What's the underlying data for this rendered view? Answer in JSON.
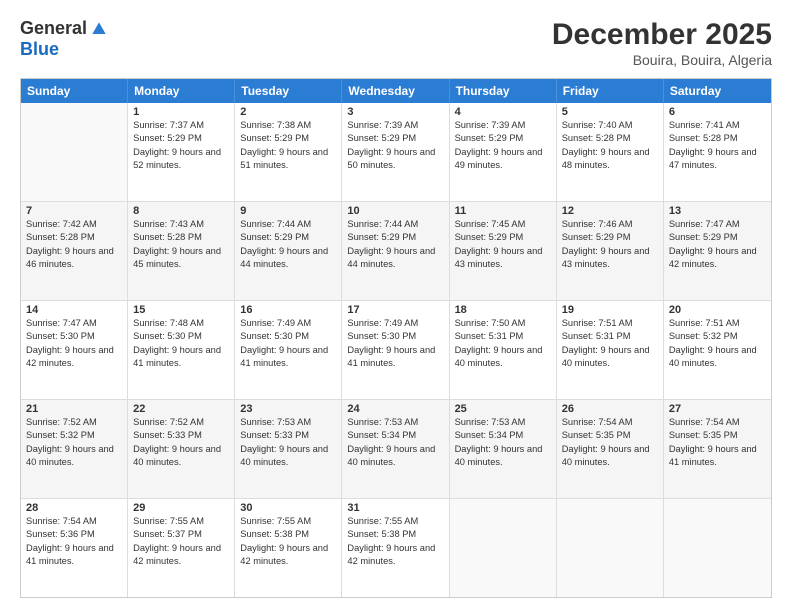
{
  "logo": {
    "general": "General",
    "blue": "Blue"
  },
  "title": "December 2025",
  "location": "Bouira, Bouira, Algeria",
  "days_of_week": [
    "Sunday",
    "Monday",
    "Tuesday",
    "Wednesday",
    "Thursday",
    "Friday",
    "Saturday"
  ],
  "weeks": [
    [
      {
        "day": "",
        "sunrise": "",
        "sunset": "",
        "daylight": ""
      },
      {
        "day": "1",
        "sunrise": "Sunrise: 7:37 AM",
        "sunset": "Sunset: 5:29 PM",
        "daylight": "Daylight: 9 hours and 52 minutes."
      },
      {
        "day": "2",
        "sunrise": "Sunrise: 7:38 AM",
        "sunset": "Sunset: 5:29 PM",
        "daylight": "Daylight: 9 hours and 51 minutes."
      },
      {
        "day": "3",
        "sunrise": "Sunrise: 7:39 AM",
        "sunset": "Sunset: 5:29 PM",
        "daylight": "Daylight: 9 hours and 50 minutes."
      },
      {
        "day": "4",
        "sunrise": "Sunrise: 7:39 AM",
        "sunset": "Sunset: 5:29 PM",
        "daylight": "Daylight: 9 hours and 49 minutes."
      },
      {
        "day": "5",
        "sunrise": "Sunrise: 7:40 AM",
        "sunset": "Sunset: 5:28 PM",
        "daylight": "Daylight: 9 hours and 48 minutes."
      },
      {
        "day": "6",
        "sunrise": "Sunrise: 7:41 AM",
        "sunset": "Sunset: 5:28 PM",
        "daylight": "Daylight: 9 hours and 47 minutes."
      }
    ],
    [
      {
        "day": "7",
        "sunrise": "Sunrise: 7:42 AM",
        "sunset": "Sunset: 5:28 PM",
        "daylight": "Daylight: 9 hours and 46 minutes."
      },
      {
        "day": "8",
        "sunrise": "Sunrise: 7:43 AM",
        "sunset": "Sunset: 5:28 PM",
        "daylight": "Daylight: 9 hours and 45 minutes."
      },
      {
        "day": "9",
        "sunrise": "Sunrise: 7:44 AM",
        "sunset": "Sunset: 5:29 PM",
        "daylight": "Daylight: 9 hours and 44 minutes."
      },
      {
        "day": "10",
        "sunrise": "Sunrise: 7:44 AM",
        "sunset": "Sunset: 5:29 PM",
        "daylight": "Daylight: 9 hours and 44 minutes."
      },
      {
        "day": "11",
        "sunrise": "Sunrise: 7:45 AM",
        "sunset": "Sunset: 5:29 PM",
        "daylight": "Daylight: 9 hours and 43 minutes."
      },
      {
        "day": "12",
        "sunrise": "Sunrise: 7:46 AM",
        "sunset": "Sunset: 5:29 PM",
        "daylight": "Daylight: 9 hours and 43 minutes."
      },
      {
        "day": "13",
        "sunrise": "Sunrise: 7:47 AM",
        "sunset": "Sunset: 5:29 PM",
        "daylight": "Daylight: 9 hours and 42 minutes."
      }
    ],
    [
      {
        "day": "14",
        "sunrise": "Sunrise: 7:47 AM",
        "sunset": "Sunset: 5:30 PM",
        "daylight": "Daylight: 9 hours and 42 minutes."
      },
      {
        "day": "15",
        "sunrise": "Sunrise: 7:48 AM",
        "sunset": "Sunset: 5:30 PM",
        "daylight": "Daylight: 9 hours and 41 minutes."
      },
      {
        "day": "16",
        "sunrise": "Sunrise: 7:49 AM",
        "sunset": "Sunset: 5:30 PM",
        "daylight": "Daylight: 9 hours and 41 minutes."
      },
      {
        "day": "17",
        "sunrise": "Sunrise: 7:49 AM",
        "sunset": "Sunset: 5:30 PM",
        "daylight": "Daylight: 9 hours and 41 minutes."
      },
      {
        "day": "18",
        "sunrise": "Sunrise: 7:50 AM",
        "sunset": "Sunset: 5:31 PM",
        "daylight": "Daylight: 9 hours and 40 minutes."
      },
      {
        "day": "19",
        "sunrise": "Sunrise: 7:51 AM",
        "sunset": "Sunset: 5:31 PM",
        "daylight": "Daylight: 9 hours and 40 minutes."
      },
      {
        "day": "20",
        "sunrise": "Sunrise: 7:51 AM",
        "sunset": "Sunset: 5:32 PM",
        "daylight": "Daylight: 9 hours and 40 minutes."
      }
    ],
    [
      {
        "day": "21",
        "sunrise": "Sunrise: 7:52 AM",
        "sunset": "Sunset: 5:32 PM",
        "daylight": "Daylight: 9 hours and 40 minutes."
      },
      {
        "day": "22",
        "sunrise": "Sunrise: 7:52 AM",
        "sunset": "Sunset: 5:33 PM",
        "daylight": "Daylight: 9 hours and 40 minutes."
      },
      {
        "day": "23",
        "sunrise": "Sunrise: 7:53 AM",
        "sunset": "Sunset: 5:33 PM",
        "daylight": "Daylight: 9 hours and 40 minutes."
      },
      {
        "day": "24",
        "sunrise": "Sunrise: 7:53 AM",
        "sunset": "Sunset: 5:34 PM",
        "daylight": "Daylight: 9 hours and 40 minutes."
      },
      {
        "day": "25",
        "sunrise": "Sunrise: 7:53 AM",
        "sunset": "Sunset: 5:34 PM",
        "daylight": "Daylight: 9 hours and 40 minutes."
      },
      {
        "day": "26",
        "sunrise": "Sunrise: 7:54 AM",
        "sunset": "Sunset: 5:35 PM",
        "daylight": "Daylight: 9 hours and 40 minutes."
      },
      {
        "day": "27",
        "sunrise": "Sunrise: 7:54 AM",
        "sunset": "Sunset: 5:35 PM",
        "daylight": "Daylight: 9 hours and 41 minutes."
      }
    ],
    [
      {
        "day": "28",
        "sunrise": "Sunrise: 7:54 AM",
        "sunset": "Sunset: 5:36 PM",
        "daylight": "Daylight: 9 hours and 41 minutes."
      },
      {
        "day": "29",
        "sunrise": "Sunrise: 7:55 AM",
        "sunset": "Sunset: 5:37 PM",
        "daylight": "Daylight: 9 hours and 42 minutes."
      },
      {
        "day": "30",
        "sunrise": "Sunrise: 7:55 AM",
        "sunset": "Sunset: 5:38 PM",
        "daylight": "Daylight: 9 hours and 42 minutes."
      },
      {
        "day": "31",
        "sunrise": "Sunrise: 7:55 AM",
        "sunset": "Sunset: 5:38 PM",
        "daylight": "Daylight: 9 hours and 42 minutes."
      },
      {
        "day": "",
        "sunrise": "",
        "sunset": "",
        "daylight": ""
      },
      {
        "day": "",
        "sunrise": "",
        "sunset": "",
        "daylight": ""
      },
      {
        "day": "",
        "sunrise": "",
        "sunset": "",
        "daylight": ""
      }
    ]
  ]
}
